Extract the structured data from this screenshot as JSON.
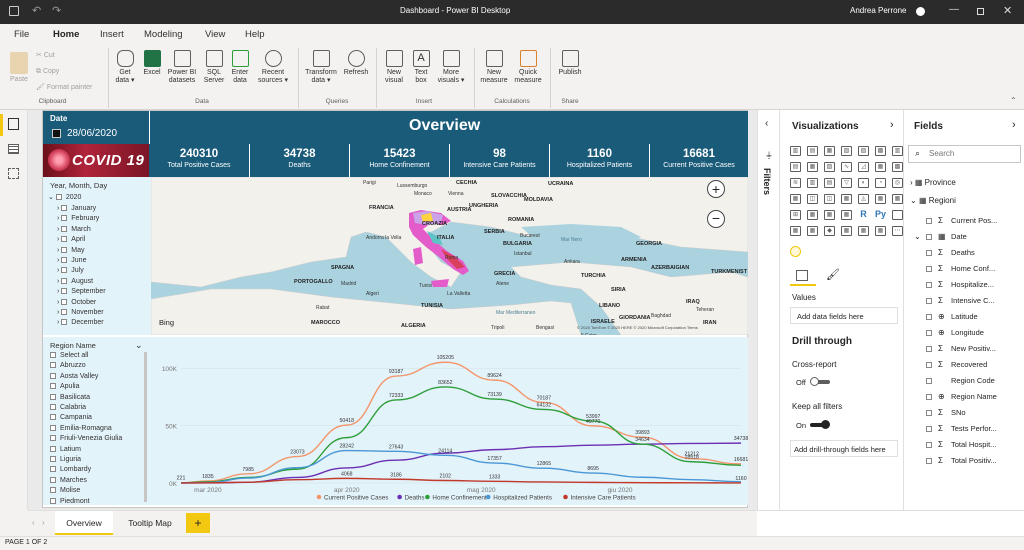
{
  "window": {
    "title": "Dashboard - Power BI Desktop",
    "user": "Andrea Perrone"
  },
  "menu": {
    "items": [
      "File",
      "Home",
      "Insert",
      "Modeling",
      "View",
      "Help"
    ],
    "active": "Home"
  },
  "ribbon": {
    "clipboard": {
      "paste": "Paste",
      "cut": "Cut",
      "copy": "Copy",
      "format_painter": "Format painter",
      "group": "Clipboard"
    },
    "data": {
      "get_data": "Get data ▾",
      "excel": "Excel",
      "pbi_datasets": "Power BI datasets",
      "sql": "SQL Server",
      "enter": "Enter data",
      "recent": "Recent sources ▾",
      "group": "Data"
    },
    "queries": {
      "transform": "Transform data ▾",
      "refresh": "Refresh",
      "group": "Queries"
    },
    "insert": {
      "new_visual": "New visual",
      "text_box": "Text box",
      "more_visuals": "More visuals ▾",
      "group": "Insert"
    },
    "calculations": {
      "new_measure": "New measure",
      "quick_measure": "Quick measure",
      "group": "Calculations"
    },
    "share": {
      "publish": "Publish",
      "group": "Share"
    }
  },
  "report": {
    "date_label": "Date",
    "date_value": "28/06/2020",
    "banner": "Overview",
    "covid_logo": "COVID 19",
    "kpis": [
      {
        "value": "240310",
        "label": "Total Positive Cases"
      },
      {
        "value": "34738",
        "label": "Deaths"
      },
      {
        "value": "15423",
        "label": "Home Confinement"
      },
      {
        "value": "98",
        "label": "Intensive Care Patients"
      },
      {
        "value": "1160",
        "label": "Hospitalized Patients"
      },
      {
        "value": "16681",
        "label": "Current Positive Cases"
      }
    ],
    "date_slicer": {
      "title": "Year, Month, Day",
      "year": "2020",
      "months": [
        "January",
        "February",
        "March",
        "April",
        "May",
        "June",
        "July",
        "August",
        "September",
        "October",
        "November",
        "December"
      ]
    },
    "region_slicer": {
      "title": "Region Name",
      "items": [
        "Select all",
        "Abruzzo",
        "Aosta Valley",
        "Apulia",
        "Basilicata",
        "Calabria",
        "Campania",
        "Emilia-Romagna",
        "Friuli-Venezia Giulia",
        "Latium",
        "Liguria",
        "Lombardy",
        "Marches",
        "Molise",
        "Piedmont"
      ]
    },
    "map": {
      "bing": "Bing",
      "copyright": "© 2020 TomTom © 2020 HERE © 2020 Microsoft Corporation Terms",
      "labels": [
        {
          "t": "Parigi"
        },
        {
          "t": "Lussemburgo"
        },
        {
          "t": "CECHIA"
        },
        {
          "t": "UCRAINA"
        },
        {
          "t": "Monaco"
        },
        {
          "t": "Vienna"
        },
        {
          "t": "SLOVACCHIA"
        },
        {
          "t": "MOLDAVIA"
        },
        {
          "t": "FRANCIA"
        },
        {
          "t": "AUSTRIA"
        },
        {
          "t": "UNGHERIA"
        },
        {
          "t": "CROAZIA"
        },
        {
          "t": "ROMANIA"
        },
        {
          "t": "SERBIA"
        },
        {
          "t": "Bucarest"
        },
        {
          "t": "ITALIA"
        },
        {
          "t": "BULGARIA"
        },
        {
          "t": "Mar Nero"
        },
        {
          "t": "Andorra la Vella"
        },
        {
          "t": "Roma"
        },
        {
          "t": "Istanbul"
        },
        {
          "t": "GEORGIA"
        },
        {
          "t": "SPAGNA"
        },
        {
          "t": "Ankara"
        },
        {
          "t": "ARMENIA"
        },
        {
          "t": "GRECIA"
        },
        {
          "t": "TURCHIA"
        },
        {
          "t": "AZERBAIGIAN"
        },
        {
          "t": "TURKMENIST"
        },
        {
          "t": "PORTOGALLO"
        },
        {
          "t": "Atene"
        },
        {
          "t": "Madrid"
        },
        {
          "t": "Tunisi"
        },
        {
          "t": "Algeri"
        },
        {
          "t": "La Valletta"
        },
        {
          "t": "SIRIA"
        },
        {
          "t": "TUNISIA"
        },
        {
          "t": "Mar Mediterraneo"
        },
        {
          "t": "LIBANO"
        },
        {
          "t": "IRAQ"
        },
        {
          "t": "MAROCCO"
        },
        {
          "t": "ALGERIA"
        },
        {
          "t": "ISRAELE"
        },
        {
          "t": "GIORDANIA"
        },
        {
          "t": "Teheran"
        },
        {
          "t": "IRAN"
        },
        {
          "t": "Baghdad"
        },
        {
          "t": "Rabat"
        },
        {
          "t": "Tripoli"
        },
        {
          "t": "Bengasi"
        },
        {
          "t": "Il Cairo"
        }
      ]
    }
  },
  "chart_data": {
    "type": "line",
    "x": [
      "2020-02-24",
      "2020-03-01",
      "2020-03-10",
      "2020-03-21",
      "2020-04-01",
      "2020-04-12",
      "2020-04-23",
      "2020-05-04",
      "2020-05-15",
      "2020-05-26",
      "2020-06-06",
      "2020-06-17",
      "2020-06-28"
    ],
    "x_ticks": [
      "mar 2020",
      "apr 2020",
      "mag 2020",
      "giu 2020"
    ],
    "y_ticks": [
      "0K",
      "50K",
      "100K"
    ],
    "ylim": [
      0,
      115000
    ],
    "legend": [
      "Current Positive Cases",
      "Deaths",
      "Home Confinement",
      "Hospitalized Patients",
      "Intensive Care Patients"
    ],
    "colors": [
      "#f4956a",
      "#6b2fb3",
      "#2e9e3a",
      "#4a97d6",
      "#c0392b"
    ],
    "series": [
      {
        "name": "Current Positive Cases",
        "values": [
          221,
          1835,
          7985,
          23073,
          50418,
          93187,
          105205,
          89624,
          70187,
          49770,
          39893,
          21212,
          16681
        ]
      },
      {
        "name": "Deaths",
        "values": [
          7,
          29,
          631,
          4825,
          13155,
          19899,
          25969,
          29079,
          31610,
          32955,
          33846,
          34448,
          34738
        ]
      },
      {
        "name": "Home Confinement",
        "values": [
          94,
          1065,
          4800,
          12090,
          39533,
          72333,
          83652,
          73139,
          64132,
          53997,
          33774,
          18518,
          15423
        ]
      },
      {
        "name": "Hospitalized Patients",
        "values": [
          101,
          401,
          4268,
          13362,
          28242,
          27643,
          24114,
          17357,
          12865,
          8695,
          5002,
          2867,
          1160
        ]
      },
      {
        "name": "Intensive Care Patients",
        "values": [
          26,
          140,
          733,
          2857,
          4023,
          3260,
          2173,
          1479,
          893,
          553,
          287,
          127,
          98
        ]
      }
    ],
    "data_labels": [
      {
        "s": 0,
        "i": 0,
        "t": "221"
      },
      {
        "s": 0,
        "i": 1,
        "t": "1835"
      },
      {
        "s": 0,
        "i": 2,
        "t": "7985"
      },
      {
        "s": 0,
        "i": 3,
        "t": "23073"
      },
      {
        "s": 0,
        "i": 4,
        "t": "50418"
      },
      {
        "s": 0,
        "i": 5,
        "t": "93187"
      },
      {
        "s": 0,
        "i": 6,
        "t": "105205"
      },
      {
        "s": 0,
        "i": 7,
        "t": "89624"
      },
      {
        "s": 0,
        "i": 8,
        "t": "70187"
      },
      {
        "s": 0,
        "i": 9,
        "t": "49770"
      },
      {
        "s": 0,
        "i": 10,
        "t": "39893"
      },
      {
        "s": 0,
        "i": 11,
        "t": "21212"
      },
      {
        "s": 0,
        "i": 12,
        "t": "16681"
      },
      {
        "s": 1,
        "i": 10,
        "t": "34634"
      },
      {
        "s": 1,
        "i": 12,
        "t": "34738"
      },
      {
        "s": 2,
        "i": 5,
        "t": "72333"
      },
      {
        "s": 2,
        "i": 6,
        "t": "83652"
      },
      {
        "s": 2,
        "i": 7,
        "t": "73139"
      },
      {
        "s": 2,
        "i": 8,
        "t": "64132"
      },
      {
        "s": 2,
        "i": 9,
        "t": "53997"
      },
      {
        "s": 2,
        "i": 11,
        "t": "18518"
      },
      {
        "s": 3,
        "i": 4,
        "t": "28242"
      },
      {
        "s": 3,
        "i": 5,
        "t": "27643"
      },
      {
        "s": 3,
        "i": 6,
        "t": "24114"
      },
      {
        "s": 3,
        "i": 7,
        "t": "17357"
      },
      {
        "s": 3,
        "i": 8,
        "t": "12865"
      },
      {
        "s": 3,
        "i": 9,
        "t": "8695"
      },
      {
        "s": 4,
        "i": 4,
        "t": "4068"
      },
      {
        "s": 4,
        "i": 5,
        "t": "3186"
      },
      {
        "s": 4,
        "i": 6,
        "t": "2102"
      },
      {
        "s": 4,
        "i": 7,
        "t": "1333"
      },
      {
        "s": 4,
        "i": 12,
        "t": "1160"
      }
    ]
  },
  "viz_pane": {
    "title": "Visualizations",
    "values_label": "Values",
    "add_fields": "Add data fields here",
    "drill_title": "Drill through",
    "cross_report": "Cross-report",
    "cross_report_state": "Off",
    "keep_filters": "Keep all filters",
    "keep_filters_state": "On",
    "add_drill": "Add drill-through fields here"
  },
  "filters_tab": "Filters",
  "fields_pane": {
    "title": "Fields",
    "search_placeholder": "Search",
    "tables": [
      "Province",
      "Regioni"
    ],
    "fields": [
      "Current Pos...",
      "Date",
      "Deaths",
      "Home Conf...",
      "Hospitalize...",
      "Intensive C...",
      "Latitude",
      "Longitude",
      "New Positiv...",
      "Recovered",
      "Region Code",
      "Region Name",
      "SNo",
      "Tests Perfor...",
      "Total Hospit...",
      "Total Positiv..."
    ]
  },
  "page_tabs": {
    "tabs": [
      "Overview",
      "Tooltip Map"
    ],
    "add": "+"
  },
  "status": "PAGE 1 OF 2"
}
